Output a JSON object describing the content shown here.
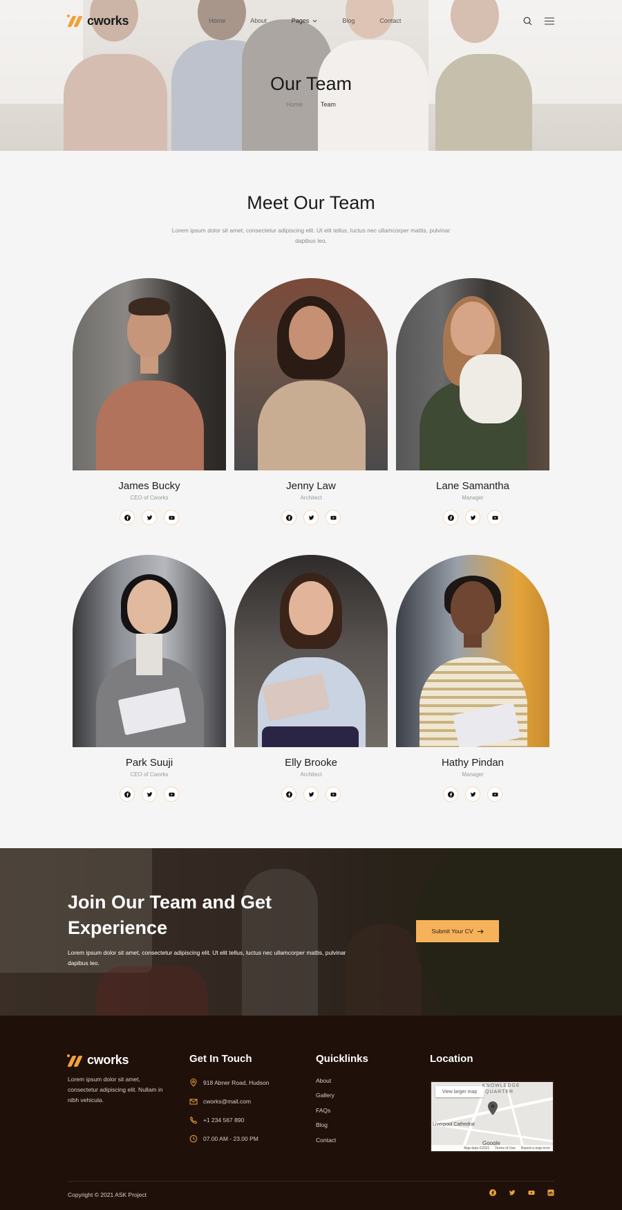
{
  "brand": {
    "name": "cworks",
    "accent": "#f0a23b"
  },
  "nav": {
    "items": [
      "Home",
      "About",
      "Pages",
      "Blog",
      "Contact"
    ],
    "search_icon": "search-icon",
    "menu_icon": "hamburger-icon"
  },
  "hero": {
    "title": "Our Team",
    "breadcrumb": {
      "home": "Home",
      "current": "Team"
    }
  },
  "team_section": {
    "title": "Meet Our Team",
    "subtitle": "Lorem ipsum dolor sit amet, consectetur adipiscing elit. Ut elit tellus, luctus nec ullamcorper mattis, pulvinar dapibus leo.",
    "members": [
      {
        "name": "James Bucky",
        "role": "CEO of Cworks"
      },
      {
        "name": "Jenny Law",
        "role": "Architect"
      },
      {
        "name": "Lane Samantha",
        "role": "Manager"
      },
      {
        "name": "Park Suuji",
        "role": "CEO of Cworks"
      },
      {
        "name": "Elly Brooke",
        "role": "Architect"
      },
      {
        "name": "Hathy Pindan",
        "role": "Manager"
      }
    ],
    "social_icons": [
      "facebook-icon",
      "twitter-icon",
      "youtube-icon"
    ]
  },
  "cta": {
    "title": "Join Our Team and Get Experience",
    "text": "Lorem ipsum dolor sit amet, consectetur adipiscing elit. Ut elit tellus, luctus nec ullamcorper mattis, pulvinar dapibus leo.",
    "button": "Submit Your CV"
  },
  "footer": {
    "about": "Lorem ipsum dolor sit amet, consectetur adipiscing elit. Nullam in nibh vehicula.",
    "get_in_touch": {
      "title": "Get In Touch",
      "address": "918 Abner Road, Hudson",
      "email": "cworks@mail.com",
      "phone": "+1 234 567 890",
      "hours": "07.00 AM - 23.00 PM"
    },
    "quicklinks": {
      "title": "Quicklinks",
      "links": [
        "About",
        "Gallery",
        "FAQs",
        "Blog",
        "Contact"
      ]
    },
    "location": {
      "title": "Location",
      "map_button": "View larger map",
      "map_labels": [
        "KNOWLEDGE",
        "QUARTER",
        "Liverpool Cathedral",
        "Google"
      ],
      "map_footer": [
        "Map data ©2021",
        "Terms of Use",
        "Report a map error"
      ]
    },
    "copyright": "Copyright © 2021 ASK Project",
    "social_icons": [
      "facebook-icon",
      "twitter-icon",
      "youtube-icon",
      "linkedin-icon"
    ]
  }
}
